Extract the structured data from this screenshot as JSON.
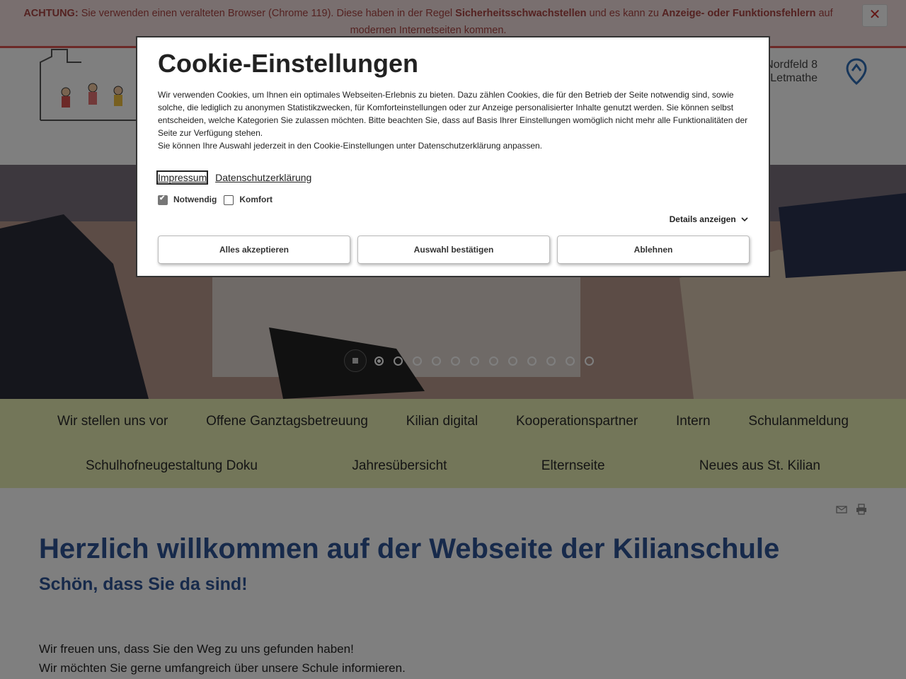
{
  "warning": {
    "prefix": "ACHTUNG:",
    "text1": "Sie verwenden einen veralteten Browser (Chrome 119). Diese haben in der Regel",
    "bold1": "Sicherheitsschwachstellen",
    "text2": "und es kann zu",
    "bold2": "Anzeige- oder Funktionsfehlern",
    "text3": "auf modernen Internetseiten kommen.",
    "close": "✕"
  },
  "header": {
    "address_line1": "Nordfeld 8",
    "address_line2": "Letmathe"
  },
  "slider": {
    "dot_count": 12,
    "active_index": 0
  },
  "nav": {
    "row1": [
      "Wir stellen uns vor",
      "Offene Ganztagsbetreuung",
      "Kilian digital",
      "Kooperationspartner",
      "Intern",
      "Schulanmeldung"
    ],
    "row2": [
      "Schulhofneugestaltung Doku",
      "Jahresübersicht",
      "Elternseite",
      "Neues aus St. Kilian"
    ]
  },
  "main": {
    "title": "Herzlich willkommen auf der Webseite der Kilianschule",
    "subtitle": "Schön, dass Sie da sind!",
    "para1": "Wir freuen uns, dass Sie den Weg zu uns gefunden haben!",
    "para2": "Wir möchten Sie gerne umfangreich über unsere Schule informieren."
  },
  "cookie": {
    "title": "Cookie-Einstellungen",
    "intro1": "Wir verwenden Cookies, um Ihnen ein optimales Webseiten-Erlebnis zu bieten. Dazu zählen Cookies, die für den Betrieb der Seite notwendig sind, sowie solche, die lediglich zu anonymen Statistikzwecken, für Komforteinstellungen oder zur Anzeige personalisierter Inhalte genutzt werden. Sie können selbst entscheiden, welche Kategorien Sie zulassen möchten. Bitte beachten Sie, dass auf Basis Ihrer Einstellungen womöglich nicht mehr alle Funktionalitäten der Seite zur Verfügung stehen.",
    "intro2": "Sie können Ihre Auswahl jederzeit in den Cookie-Einstellungen unter Datenschutzerklärung anpassen.",
    "link_impressum": "Impressum",
    "link_datenschutz": "Datenschutzerklärung",
    "check_notwendig": "Notwendig",
    "check_komfort": "Komfort",
    "details": "Details anzeigen",
    "btn_accept_all": "Alles akzeptieren",
    "btn_confirm": "Auswahl bestätigen",
    "btn_reject": "Ablehnen"
  }
}
